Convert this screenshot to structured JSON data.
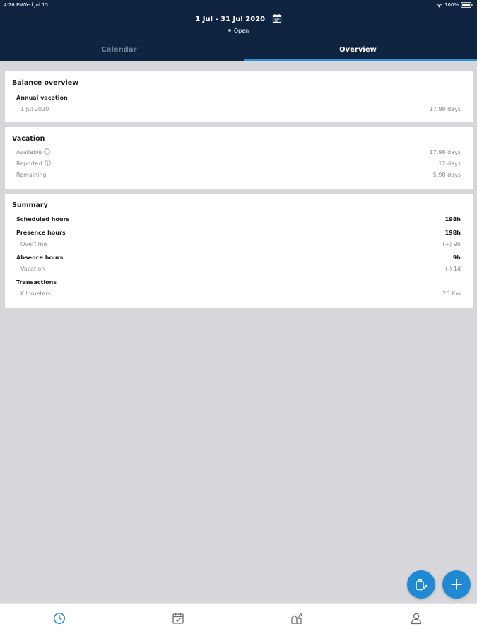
{
  "status_bar": {
    "time": "4:26 PM",
    "date": "Wed Jul 15",
    "battery": "100%"
  },
  "header": {
    "period": "1 Jul - 31 Jul 2020",
    "status": "Open",
    "tabs": [
      {
        "label": "Calendar",
        "active": false
      },
      {
        "label": "Overview",
        "active": true
      }
    ]
  },
  "balance": {
    "title": "Balance overview",
    "group": "Annual vacation",
    "rows": [
      {
        "label": "1 Jul 2020",
        "value": "17.98 days"
      }
    ]
  },
  "vacation": {
    "title": "Vacation",
    "rows": [
      {
        "label": "Available",
        "value": "17.98 days"
      },
      {
        "label": "Reported",
        "value": "12 days"
      },
      {
        "label": "Remaining",
        "value": "5.98 days"
      }
    ]
  },
  "summary": {
    "title": "Summary",
    "rows": [
      {
        "label": "Scheduled hours",
        "value": "198h"
      },
      {
        "label": "Presence hours",
        "value": "198h"
      },
      {
        "label": "Overtime",
        "value": "(+) 9h"
      },
      {
        "label": "Absence hours",
        "value": "9h"
      },
      {
        "label": "Vacation",
        "value": "(-) 1d"
      },
      {
        "label": "Transactions",
        "value": ""
      },
      {
        "label": "Kilometers",
        "value": "25 Km"
      }
    ]
  },
  "colors": {
    "header_bg": "#0f2440",
    "accent": "#1f8ad3",
    "background": "#d7d6db"
  },
  "bottom_nav": [
    "clock-icon",
    "calendar-check-icon",
    "expense-icon",
    "person-icon"
  ]
}
